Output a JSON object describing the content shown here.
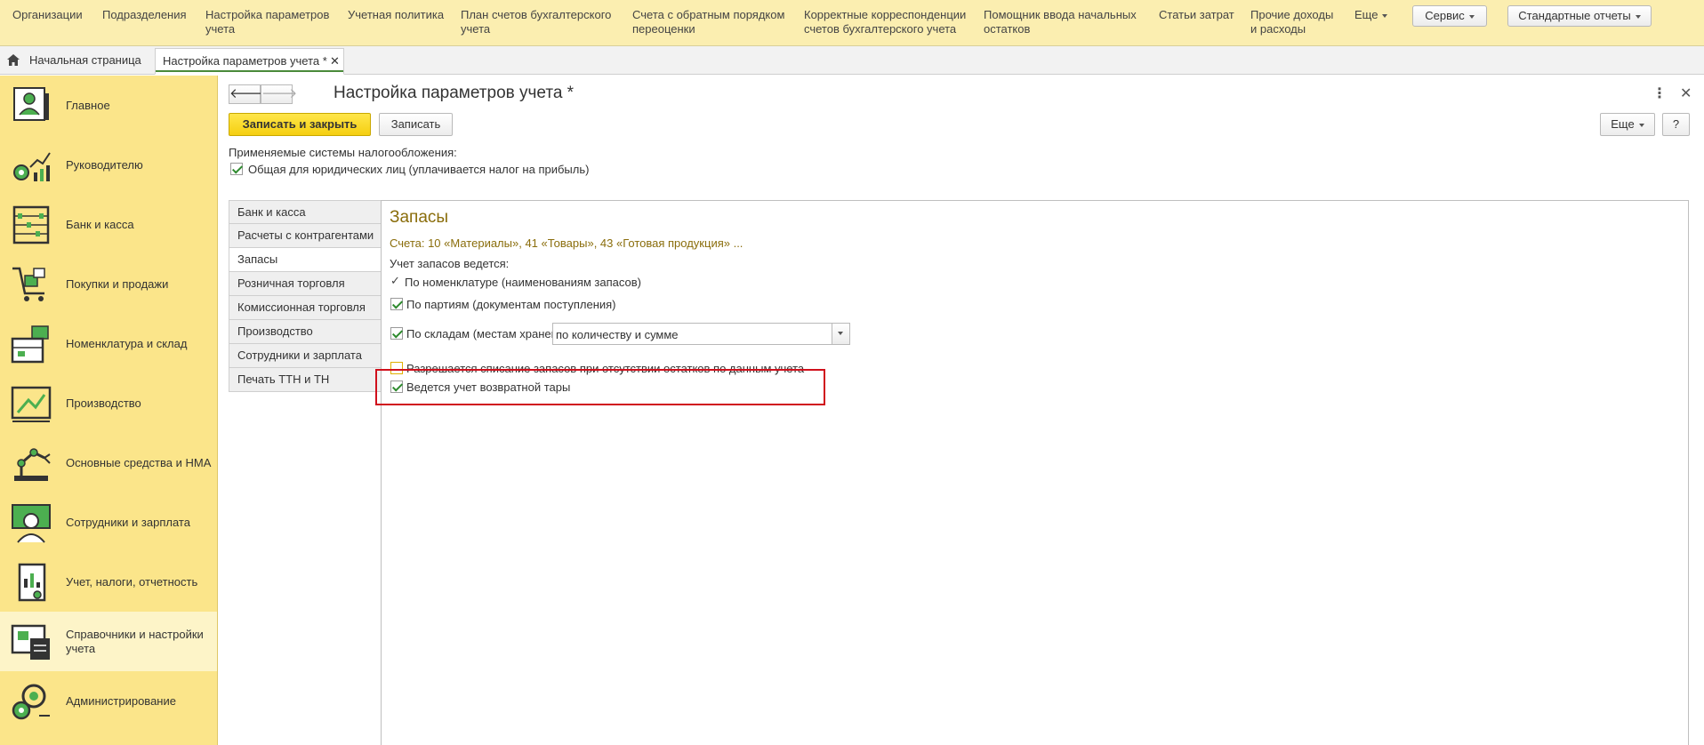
{
  "topbar": {
    "items": [
      "Организации",
      "Подразделения",
      "Настройка параметров\nучета",
      "Учетная политика",
      "План счетов бухгалтерского\nучета",
      "Счета с обратным порядком\nпереоценки",
      "Корректные корреспонденции\nсчетов бухгалтерского учета",
      "Помощник ввода начальных\nостатков",
      "Статьи затрат",
      "Прочие доходы\nи расходы"
    ],
    "more_label": "Еще",
    "service_label": "Сервис",
    "reports_label": "Стандартные отчеты"
  },
  "tabs": {
    "home_label": "Начальная страница",
    "active_label": "Настройка параметров учета *"
  },
  "sidebar": {
    "items": [
      {
        "label": "Главное",
        "icon": "user-profile-icon"
      },
      {
        "label": "Руководителю",
        "icon": "manager-chart-icon"
      },
      {
        "label": "Банк и касса",
        "icon": "abacus-icon"
      },
      {
        "label": "Покупки и продажи",
        "icon": "cart-boxes-icon"
      },
      {
        "label": "Номенклатура и склад",
        "icon": "warehouse-boxes-icon"
      },
      {
        "label": "Производство",
        "icon": "production-icon"
      },
      {
        "label": "Основные средства и НМА",
        "icon": "robot-arm-icon"
      },
      {
        "label": "Сотрудники и зарплата",
        "icon": "employee-icon"
      },
      {
        "label": "Учет, налоги, отчетность",
        "icon": "report-icon"
      },
      {
        "label": "Справочники и настройки учета",
        "icon": "reference-books-icon"
      },
      {
        "label": "Администрирование",
        "icon": "gears-icon"
      }
    ]
  },
  "form": {
    "title": "Настройка параметров учета *",
    "save_close_label": "Записать и закрыть",
    "save_label": "Записать",
    "more_label": "Еще",
    "help_label": "?",
    "tax_systems_label": "Применяемые системы налогообложения:",
    "tax_general_label": "Общая для юридических лиц (уплачивается налог на прибыль)",
    "vtabs": [
      "Банк и касса",
      "Расчеты с контрагентами",
      "Запасы",
      "Розничная торговля",
      "Комиссионная торговля",
      "Производство",
      "Сотрудники и зарплата",
      "Печать ТТН и ТН"
    ],
    "active_vtab": "Запасы",
    "section": {
      "title": "Запасы",
      "accounts": "Счета: 10 «Материалы», 41 «Товары», 43 «Готовая продукция» ...",
      "inventory_header": "Учет запасов ведется:",
      "by_nomenclature": "По номенклатуре (наименованиям запасов)",
      "by_batches": "По партиям (документам поступления)",
      "by_warehouses": "По складам (местам хранения):",
      "warehouse_mode": "по количеству и сумме",
      "allow_writeoff": "Разрешается списание запасов при отсутствии остатков по данным учета",
      "returnable_packaging": "Ведется учет возвратной тары"
    }
  },
  "colors": {
    "topbar_bg": "#fbeeb0",
    "sidebar_bg": "#fbe58a",
    "accent_green": "#3a9a45",
    "section_title": "#8a6d0b",
    "highlight_red": "#d0101c",
    "primary_button": "#f5cf10"
  }
}
